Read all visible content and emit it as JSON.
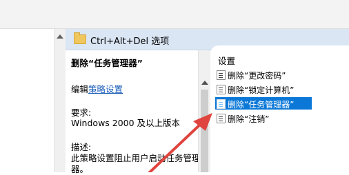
{
  "header": {
    "title": "Ctrl+Alt+Del 选项"
  },
  "description": {
    "policy_title": "删除“任务管理器”",
    "edit_prefix": "编辑",
    "edit_link": "策略设置",
    "requirements_label": "要求:",
    "requirements_value": "Windows 2000 及以上版本",
    "description_label": "描述:",
    "description_line1": "此策略设置阻止用户启动任务管理器",
    "description_line2": "器。"
  },
  "settings": {
    "header": "设置",
    "items": [
      {
        "label": "删除“更改密码”"
      },
      {
        "label": "删除“锁定计算机”"
      },
      {
        "label": "删除“任务管理器”",
        "selected": true
      },
      {
        "label": "删除“注销”"
      }
    ]
  },
  "colors": {
    "header_bg": "#dbe6f4",
    "selection": "#0b78d7",
    "annotation_arrow": "#e0443e"
  }
}
